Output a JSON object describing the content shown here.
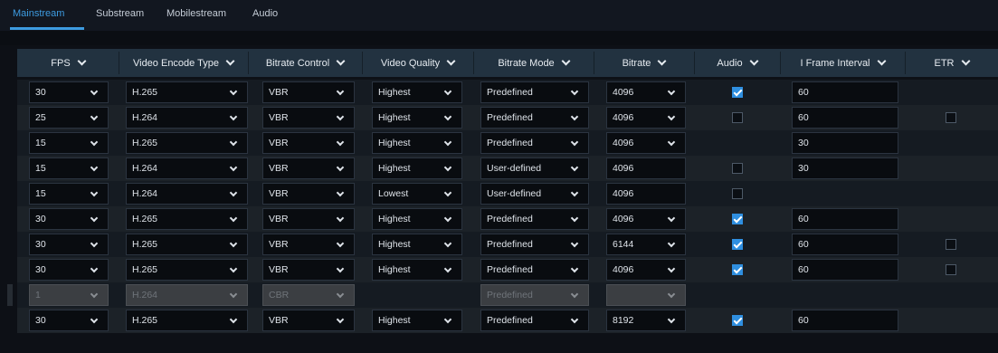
{
  "tabs": [
    {
      "label": "Mainstream",
      "active": true
    },
    {
      "label": "Substream",
      "active": false
    },
    {
      "label": "Mobilestream",
      "active": false
    },
    {
      "label": "Audio",
      "active": false
    }
  ],
  "columns": [
    "FPS",
    "Video Encode Type",
    "Bitrate Control",
    "Video Quality",
    "Bitrate Mode",
    "Bitrate",
    "Audio",
    "I Frame Interval",
    "ETR"
  ],
  "rows": [
    {
      "fps": "30",
      "encode": "H.265",
      "control": "VBR",
      "quality": "Highest",
      "mode": "Predefined",
      "bitrate": "4096",
      "bitrate_dropdown": true,
      "audio": "checked",
      "iframe": "60",
      "etr": null,
      "disabled": false
    },
    {
      "fps": "25",
      "encode": "H.264",
      "control": "VBR",
      "quality": "Highest",
      "mode": "Predefined",
      "bitrate": "4096",
      "bitrate_dropdown": true,
      "audio": "unchecked",
      "iframe": "60",
      "etr": "unchecked",
      "disabled": false
    },
    {
      "fps": "15",
      "encode": "H.265",
      "control": "VBR",
      "quality": "Highest",
      "mode": "Predefined",
      "bitrate": "4096",
      "bitrate_dropdown": true,
      "audio": null,
      "iframe": "30",
      "etr": null,
      "disabled": false
    },
    {
      "fps": "15",
      "encode": "H.264",
      "control": "VBR",
      "quality": "Highest",
      "mode": "User-defined",
      "bitrate": "4096",
      "bitrate_dropdown": false,
      "audio": "unchecked",
      "iframe": "30",
      "etr": null,
      "disabled": false
    },
    {
      "fps": "15",
      "encode": "H.264",
      "control": "VBR",
      "quality": "Lowest",
      "mode": "User-defined",
      "bitrate": "4096",
      "bitrate_dropdown": false,
      "audio": "unchecked",
      "iframe": null,
      "etr": null,
      "disabled": false
    },
    {
      "fps": "30",
      "encode": "H.265",
      "control": "VBR",
      "quality": "Highest",
      "mode": "Predefined",
      "bitrate": "4096",
      "bitrate_dropdown": true,
      "audio": "checked",
      "iframe": "60",
      "etr": null,
      "disabled": false
    },
    {
      "fps": "30",
      "encode": "H.265",
      "control": "VBR",
      "quality": "Highest",
      "mode": "Predefined",
      "bitrate": "6144",
      "bitrate_dropdown": true,
      "audio": "checked",
      "iframe": "60",
      "etr": "unchecked",
      "disabled": false
    },
    {
      "fps": "30",
      "encode": "H.265",
      "control": "VBR",
      "quality": "Highest",
      "mode": "Predefined",
      "bitrate": "4096",
      "bitrate_dropdown": true,
      "audio": "checked",
      "iframe": "60",
      "etr": "unchecked",
      "disabled": false
    },
    {
      "fps": "1",
      "encode": "H.264",
      "control": "CBR",
      "quality": null,
      "mode": "Predefined",
      "bitrate": "",
      "bitrate_dropdown": true,
      "audio": null,
      "iframe": null,
      "etr": null,
      "disabled": true
    },
    {
      "fps": "30",
      "encode": "H.265",
      "control": "VBR",
      "quality": "Highest",
      "mode": "Predefined",
      "bitrate": "8192",
      "bitrate_dropdown": true,
      "audio": "checked",
      "iframe": "60",
      "etr": null,
      "disabled": false
    }
  ],
  "colors": {
    "accent": "#3d9be0",
    "header_bg": "#223240",
    "checkbox_checked": "#2f8fe0"
  },
  "icons": {
    "dropdown": "chevron-down-icon",
    "checkbox": "checkmark-icon"
  }
}
